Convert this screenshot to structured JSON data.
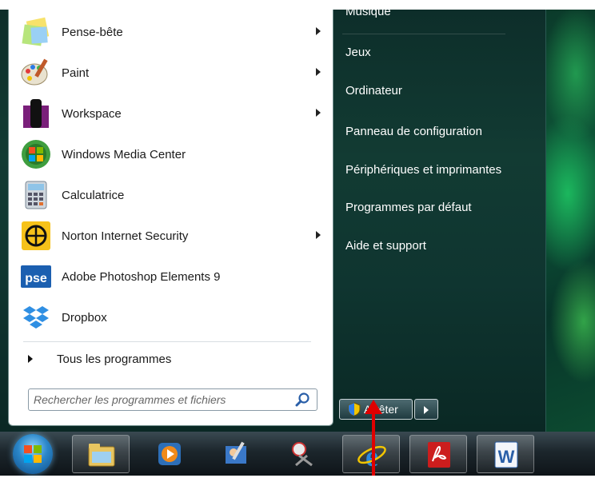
{
  "left_programs": [
    {
      "label": "Pense-bête",
      "icon": "sticky-notes-icon",
      "has_submenu": true
    },
    {
      "label": "Paint",
      "icon": "paint-palette-icon",
      "has_submenu": true
    },
    {
      "label": "Workspace",
      "icon": "workspace-icon",
      "has_submenu": true
    },
    {
      "label": "Windows Media Center",
      "icon": "media-center-icon",
      "has_submenu": false
    },
    {
      "label": "Calculatrice",
      "icon": "calculator-icon",
      "has_submenu": false
    },
    {
      "label": "Norton Internet Security",
      "icon": "norton-icon",
      "has_submenu": true
    },
    {
      "label": "Adobe Photoshop Elements 9",
      "icon": "photoshop-elements-icon",
      "has_submenu": false
    },
    {
      "label": "Dropbox",
      "icon": "dropbox-icon",
      "has_submenu": false
    }
  ],
  "all_programs_label": "Tous les programmes",
  "search": {
    "placeholder": "Rechercher les programmes et fichiers",
    "icon": "magnifier-icon"
  },
  "right_links": [
    "Musique",
    "Jeux",
    "Ordinateur",
    "Panneau de configuration",
    "Périphériques et imprimantes",
    "Programmes par défaut",
    "Aide et support"
  ],
  "shutdown": {
    "label": "Arrêter",
    "icon": "uac-shield-icon"
  },
  "taskbar": {
    "start_icon": "windows-orb-icon",
    "items": [
      "explorer-icon",
      "media-player-icon",
      "personalize-icon",
      "snipping-tool-icon",
      "internet-explorer-icon",
      "acrobat-icon",
      "word-icon"
    ]
  },
  "colors": {
    "menu_dark": "#0f3530",
    "accent_arrow": "#e00000",
    "taskbar": "#1c262c"
  }
}
